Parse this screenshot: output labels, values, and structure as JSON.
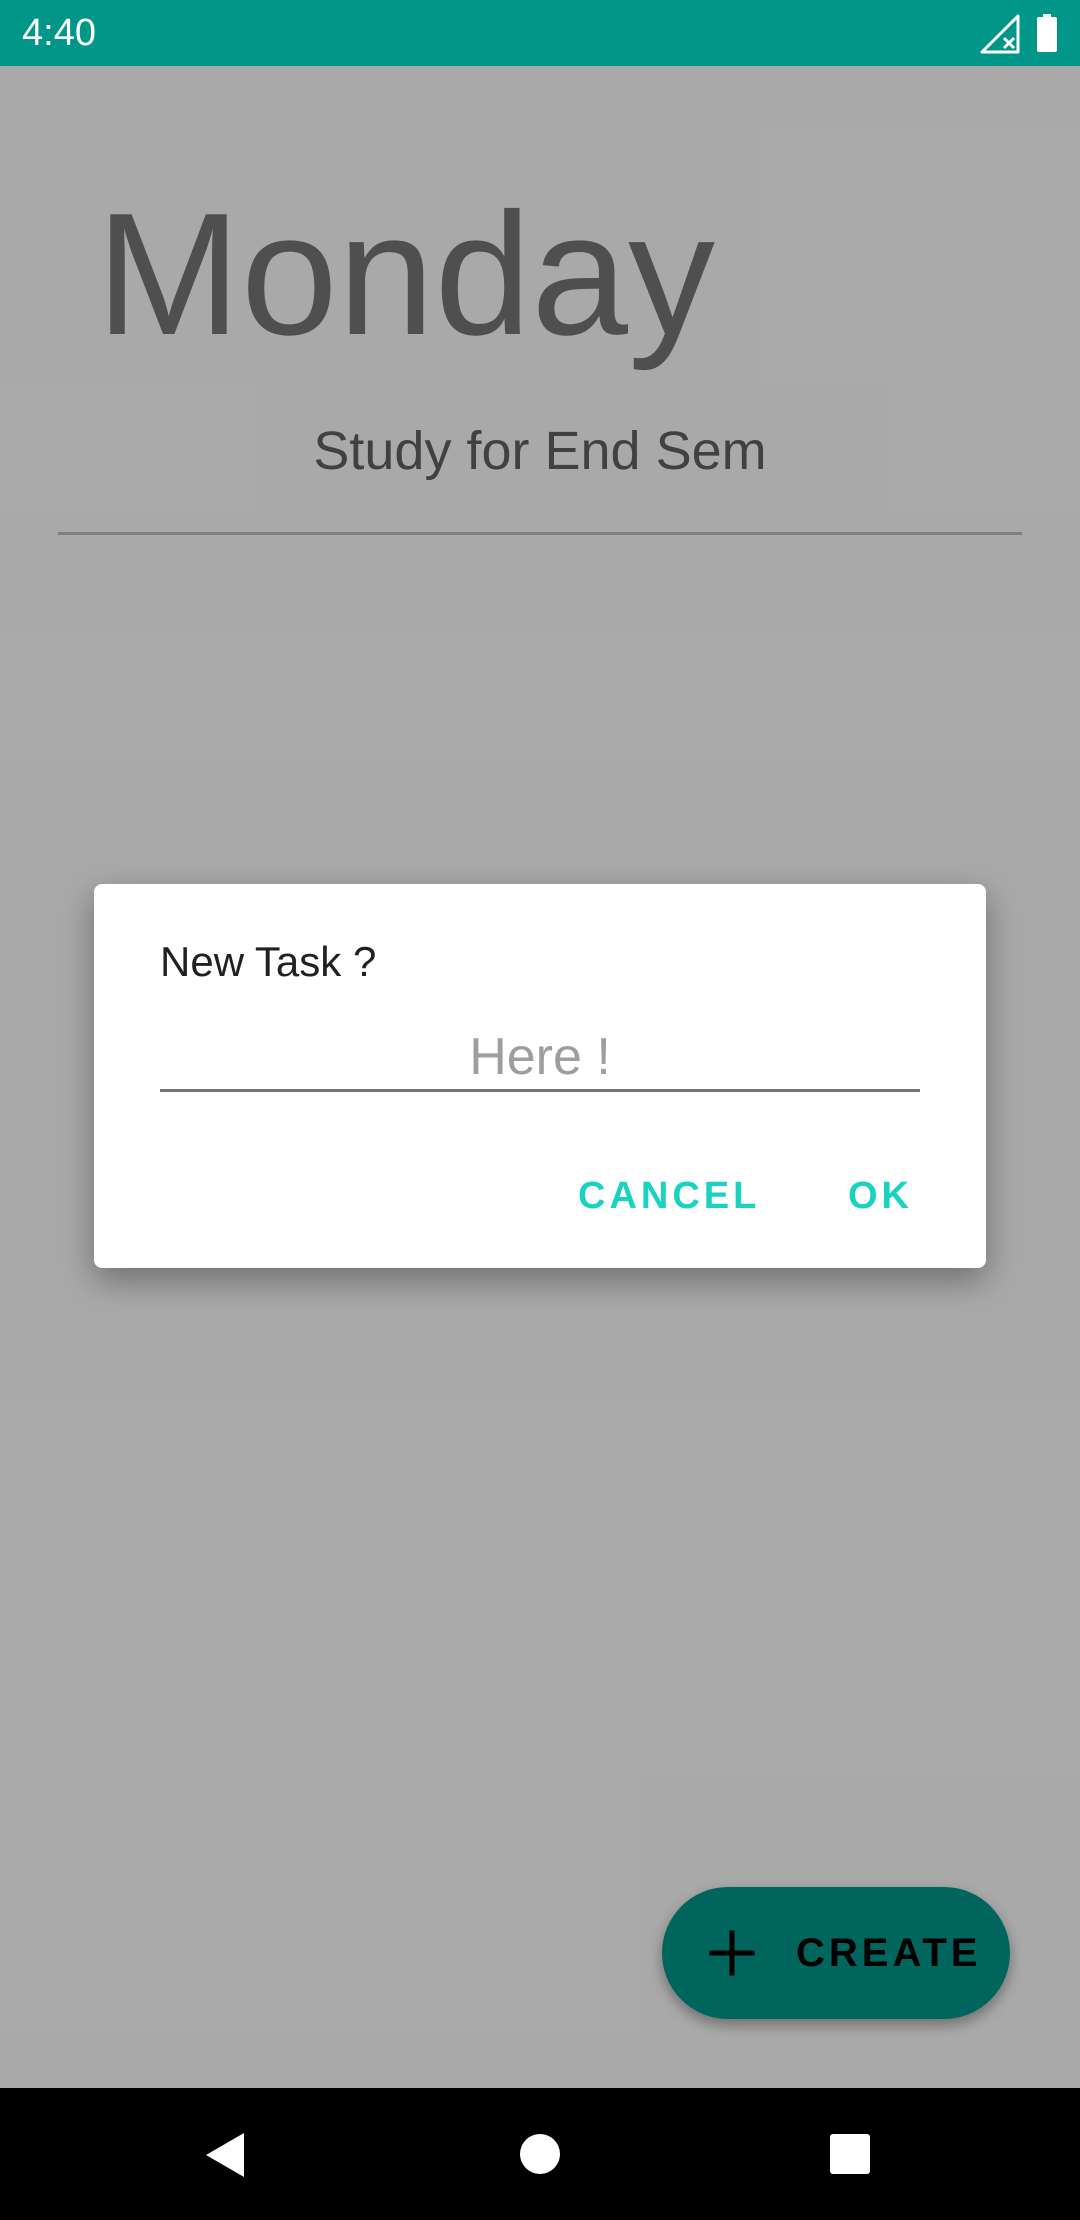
{
  "status_bar": {
    "time": "4:40",
    "icons": [
      "signal-off-icon",
      "battery-full-icon"
    ],
    "color": "#009688"
  },
  "app": {
    "day_title": "Monday",
    "tasks": [
      "Study for End Sem"
    ],
    "fab": {
      "label": "CREATE",
      "icon": "plus-icon",
      "color": "#009688"
    }
  },
  "dialog": {
    "title": "New Task ?",
    "input_value": "",
    "input_placeholder": "Here !",
    "cancel_label": "CANCEL",
    "ok_label": "OK",
    "accent_color": "#19d3c0"
  },
  "nav_bar": {
    "icons": [
      "back-icon",
      "home-icon",
      "recents-icon"
    ]
  }
}
